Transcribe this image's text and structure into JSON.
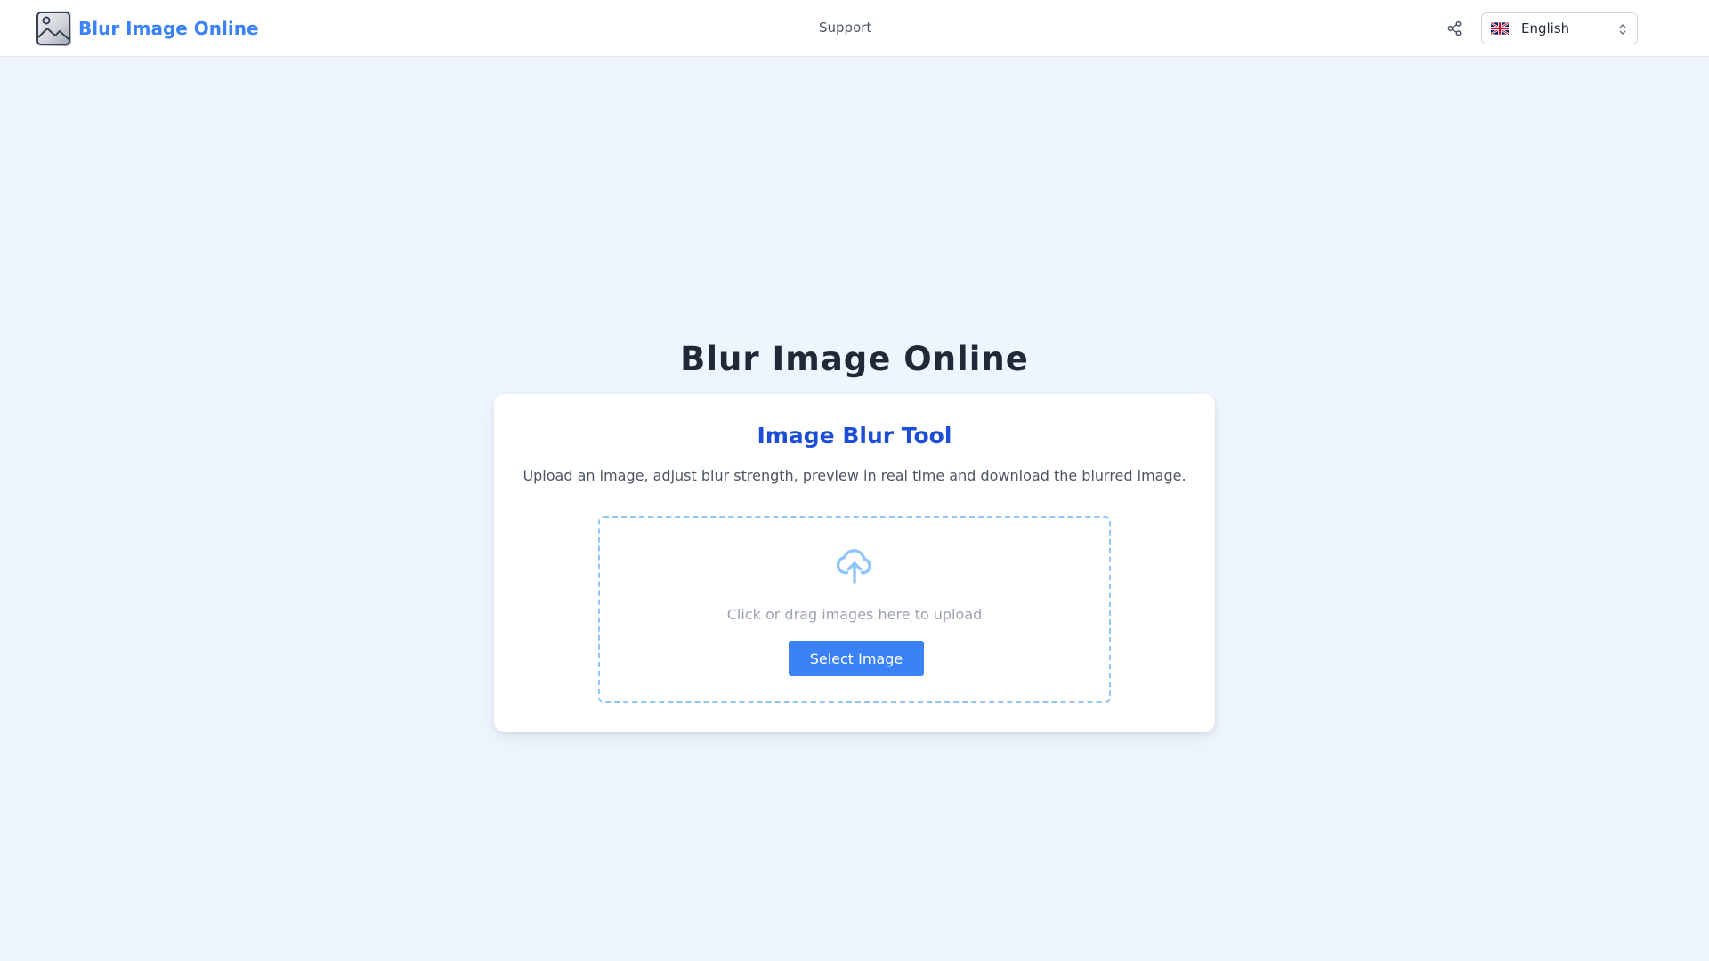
{
  "header": {
    "brand_name": "Blur Image Online",
    "brand_icon": "blurred-image-icon",
    "nav": {
      "support_label": "Support"
    },
    "share_icon": "share-icon",
    "language": {
      "selected": "English",
      "flag_icon": "uk-flag-icon",
      "chevron_icon": "chevron-up-down-icon"
    }
  },
  "main": {
    "title": "Blur Image Online",
    "card": {
      "title": "Image Blur Tool",
      "description": "Upload an image, adjust blur strength, preview in real time and download the blurred image.",
      "dropzone": {
        "icon": "cloud-upload-icon",
        "text": "Click or drag images here to upload",
        "button_label": "Select Image"
      }
    }
  },
  "colors": {
    "page_bg": "#eef5fe",
    "brand": "#3b82f6",
    "card_title": "#1d4ed8",
    "button": "#3b82f6",
    "dropzone_border": "#93c5fd"
  }
}
